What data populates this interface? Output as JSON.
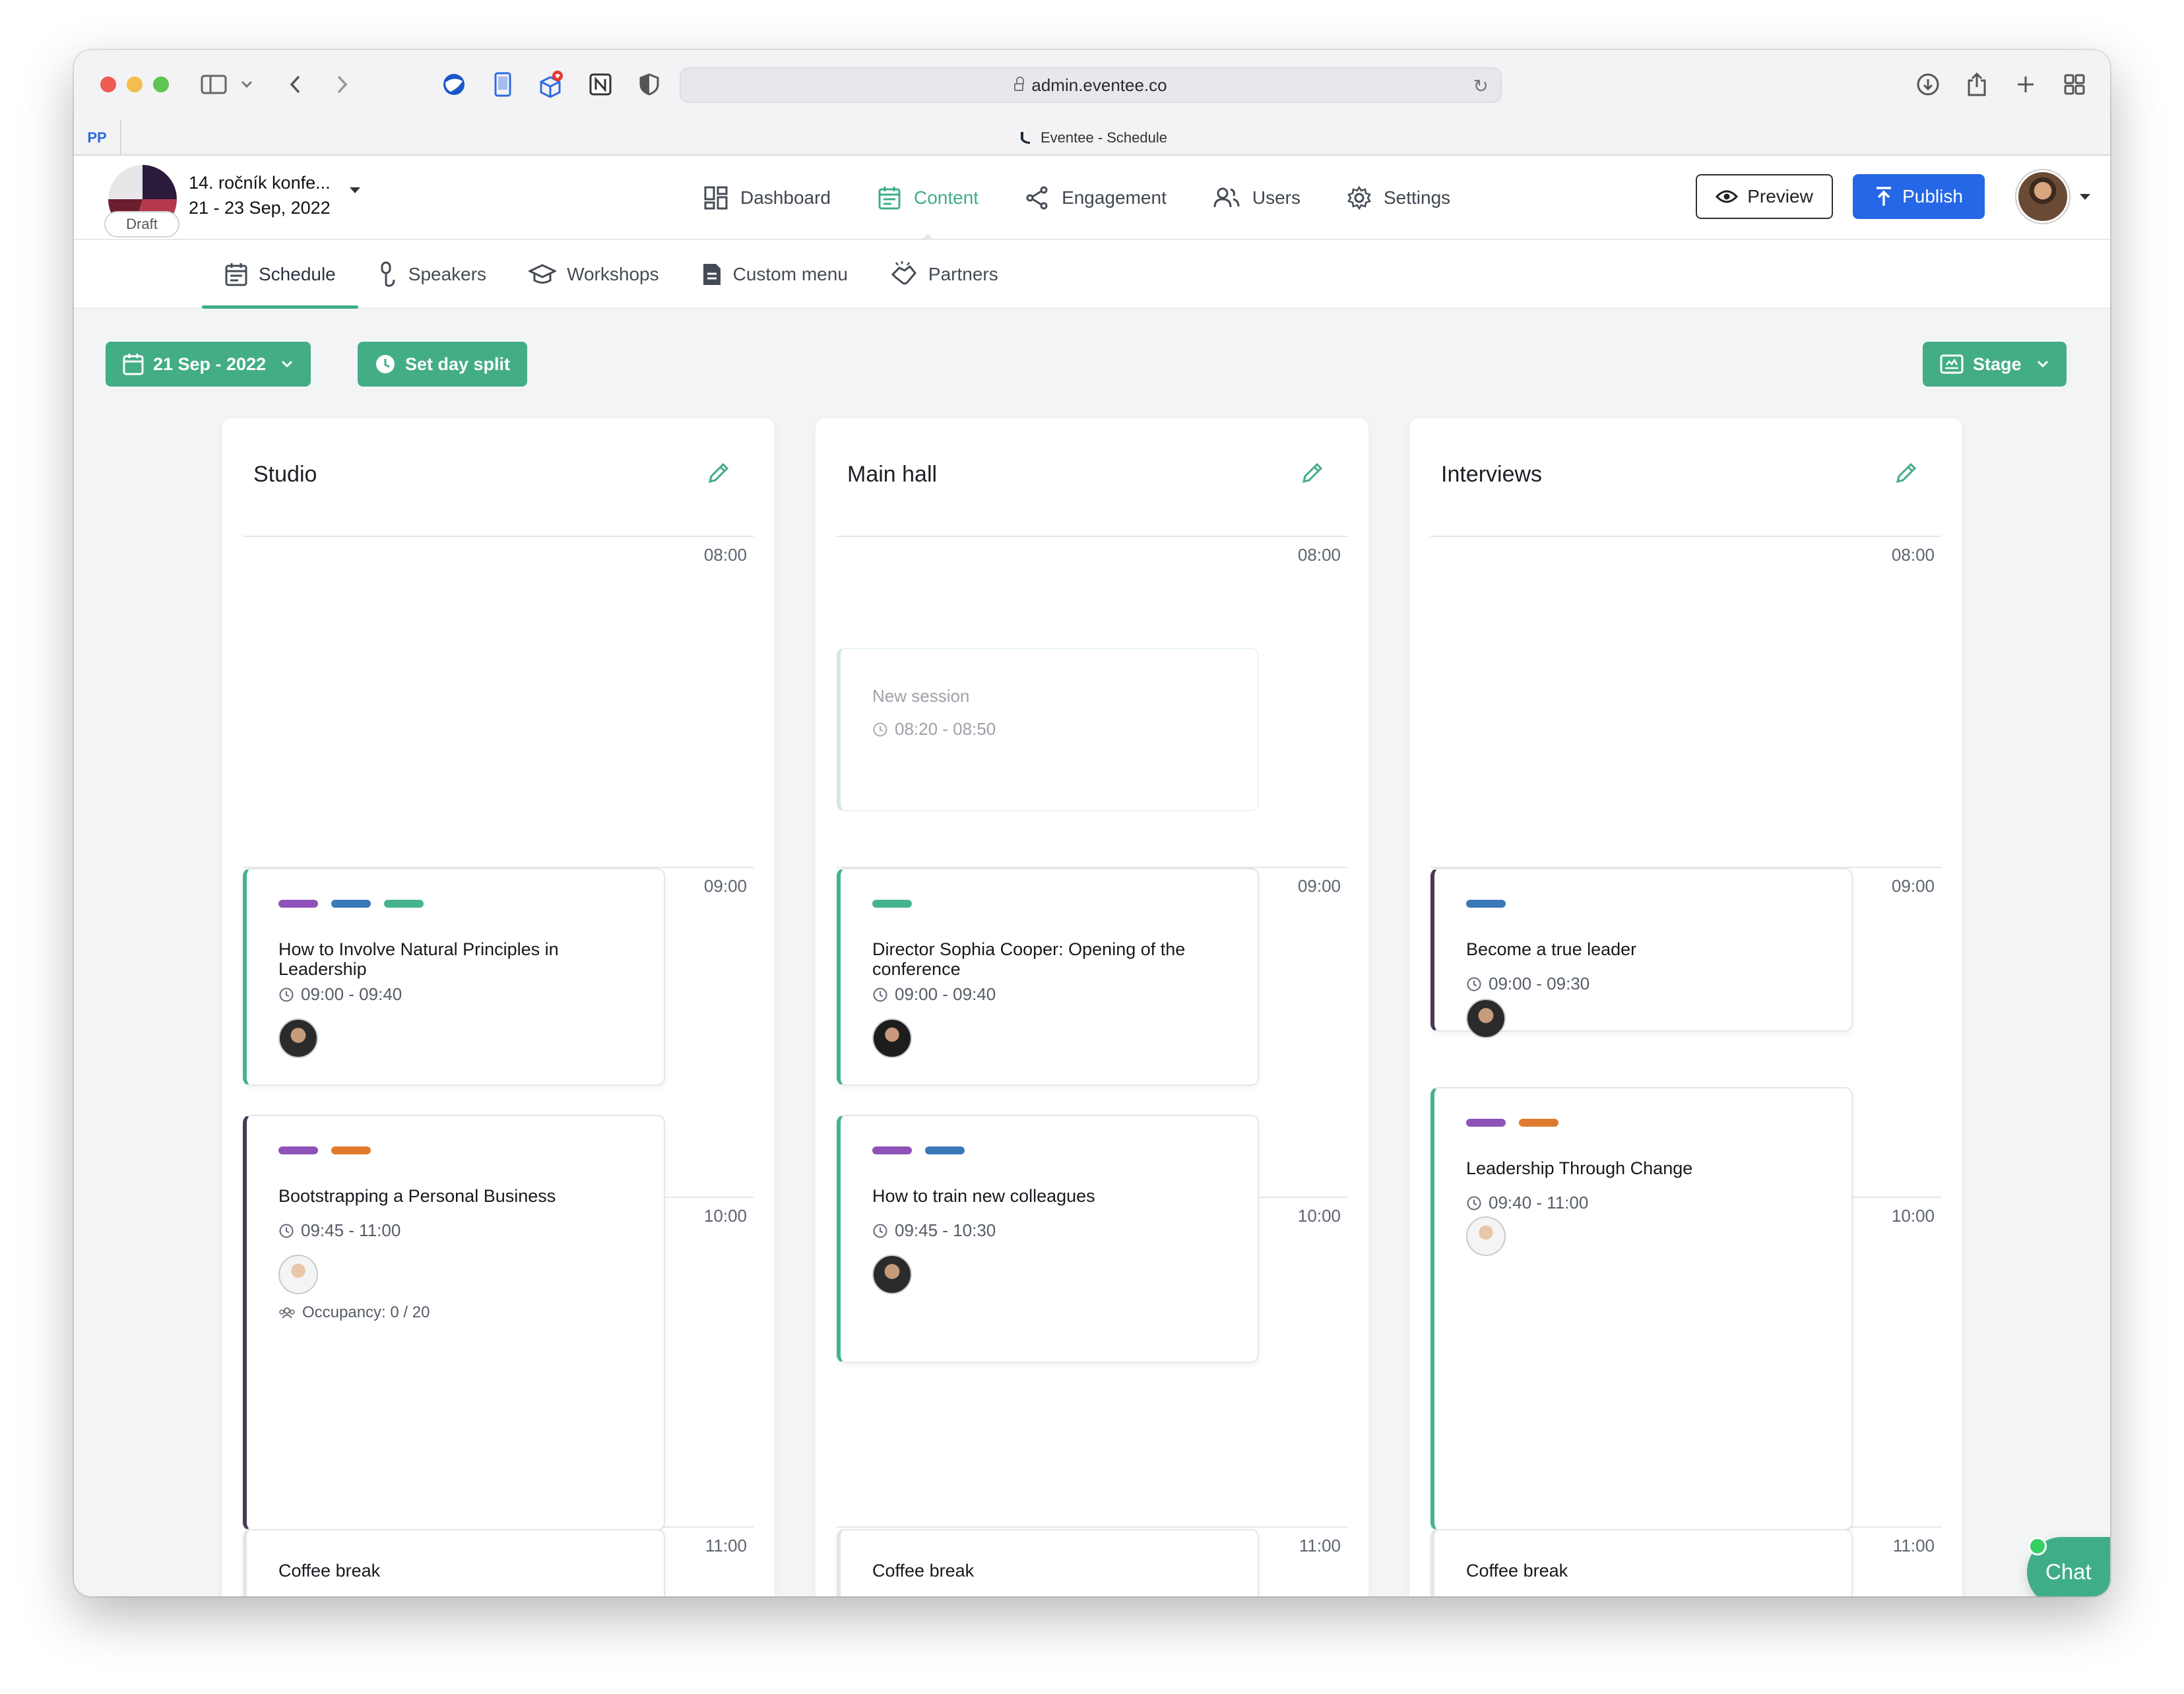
{
  "browser": {
    "url": "admin.eventee.co",
    "tab_title": "Eventee - Schedule",
    "pinned_tab_label": "PP"
  },
  "event": {
    "title": "14. ročník konfe...",
    "dates": "21 - 23 Sep, 2022",
    "status": "Draft"
  },
  "main_nav": [
    {
      "label": "Dashboard",
      "icon": "dashboard-icon",
      "active": false
    },
    {
      "label": "Content",
      "icon": "calendar-icon",
      "active": true
    },
    {
      "label": "Engagement",
      "icon": "share-icon",
      "active": false
    },
    {
      "label": "Users",
      "icon": "users-icon",
      "active": false
    },
    {
      "label": "Settings",
      "icon": "gear-icon",
      "active": false
    }
  ],
  "actions": {
    "preview_label": "Preview",
    "publish_label": "Publish"
  },
  "sub_nav": [
    {
      "label": "Schedule",
      "active": true
    },
    {
      "label": "Speakers",
      "active": false
    },
    {
      "label": "Workshops",
      "active": false
    },
    {
      "label": "Custom menu",
      "active": false
    },
    {
      "label": "Partners",
      "active": false
    }
  ],
  "toolbar": {
    "date_label": "21 Sep - 2022",
    "day_split_label": "Set day split",
    "stage_label": "Stage"
  },
  "columns": [
    {
      "title": "Studio",
      "hours": [
        "08:00",
        "09:00",
        "10:00",
        "11:00"
      ],
      "sessions": [
        {
          "title": "How to Involve Natural Principles in Leadership",
          "time": "09:00 - 09:40",
          "tags": [
            "#8e52b8",
            "#3a78b8",
            "#45b38c"
          ],
          "accent": "#45b38c"
        },
        {
          "title": "Bootstrapping a Personal Business",
          "time": "09:45 - 11:00",
          "tags": [
            "#8e52b8",
            "#e07a2e"
          ],
          "accent": "#4a3857",
          "occupancy": "Occupancy: 0 / 20"
        },
        {
          "title": "Coffee break",
          "accent": "#e3e6e9"
        }
      ]
    },
    {
      "title": "Main hall",
      "hours": [
        "08:00",
        "09:00",
        "10:00",
        "11:00"
      ],
      "sessions": [
        {
          "title": "New session",
          "time": "08:20 - 08:50",
          "ghost": true
        },
        {
          "title": "Director Sophia Cooper: Opening of the conference",
          "time": "09:00 - 09:40",
          "tags": [
            "#45b38c"
          ],
          "accent": "#45b38c"
        },
        {
          "title": "How to train new colleagues",
          "time": "09:45 - 10:30",
          "tags": [
            "#8e52b8",
            "#3a78b8"
          ],
          "accent": "#45b38c"
        },
        {
          "title": "Coffee break",
          "accent": "#e3e6e9"
        }
      ]
    },
    {
      "title": "Interviews",
      "hours": [
        "08:00",
        "09:00",
        "10:00",
        "11:00"
      ],
      "sessions": [
        {
          "title": "Become a true leader",
          "time": "09:00 - 09:30",
          "tags": [
            "#3a78b8"
          ],
          "accent": "#4a3857"
        },
        {
          "title": "Leadership Through Change",
          "time": "09:40 - 11:00",
          "tags": [
            "#8e52b8",
            "#e07a2e"
          ],
          "accent": "#45b38c"
        },
        {
          "title": "Coffee break",
          "accent": "#e3e6e9"
        }
      ]
    }
  ],
  "chat": {
    "label": "Chat"
  },
  "colors": {
    "accent_green": "#43ad86",
    "publish_blue": "#2567e6"
  }
}
